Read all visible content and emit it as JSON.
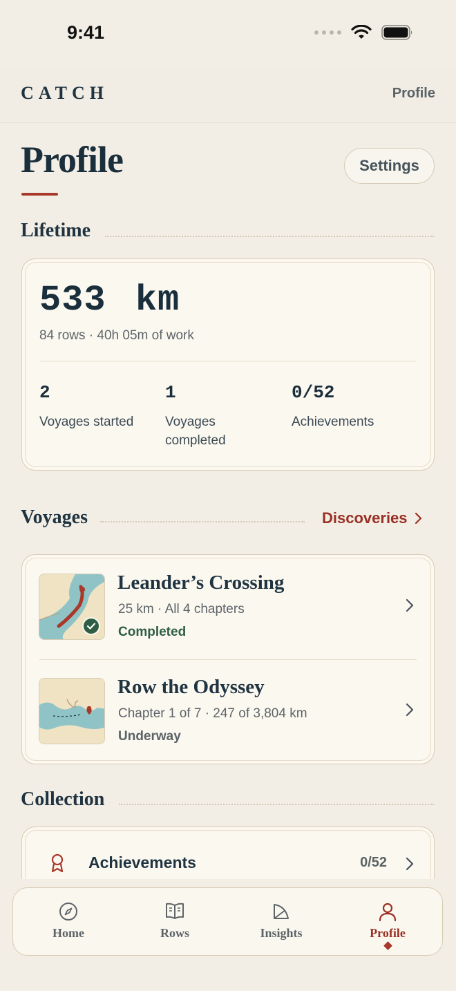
{
  "status_bar": {
    "time": "9:41"
  },
  "header": {
    "brand": "CATCH",
    "page_label": "Profile"
  },
  "page": {
    "title": "Profile",
    "settings_label": "Settings"
  },
  "lifetime": {
    "heading": "Lifetime",
    "distance_value": "533",
    "distance_unit": "km",
    "summary": "84 rows · 40h 05m of work",
    "stats": [
      {
        "value": "2",
        "label": "Voyages started"
      },
      {
        "value": "1",
        "label": "Voyages completed"
      },
      {
        "value": "0/52",
        "label": "Achievements"
      }
    ]
  },
  "voyages": {
    "heading": "Voyages",
    "discoveries_label": "Discoveries",
    "items": [
      {
        "title": "Leander’s Crossing",
        "meta": "25 km · All 4 chapters",
        "status": "Completed",
        "status_color": "#2f5e45",
        "thumb_icon": "strait-map-thumbnail"
      },
      {
        "title": "Row the Odyssey",
        "meta": "Chapter 1 of 7 · 247 of 3,804 km",
        "status": "Underway",
        "status_color": "#5a6266",
        "thumb_icon": "mediterranean-map-thumbnail"
      }
    ]
  },
  "collection": {
    "heading": "Collection",
    "items": [
      {
        "title": "Achievements",
        "count": "0/52",
        "icon": "ribbon-award-icon"
      }
    ]
  },
  "tabs": [
    {
      "label": "Home",
      "icon": "compass-icon",
      "active": false
    },
    {
      "label": "Rows",
      "icon": "book-icon",
      "active": false
    },
    {
      "label": "Insights",
      "icon": "chart-icon",
      "active": false
    },
    {
      "label": "Profile",
      "icon": "person-icon",
      "active": true
    }
  ],
  "colors": {
    "accent": "#9a3124",
    "ink": "#1f3340",
    "background": "#f2eee6",
    "card": "#fbf8f0"
  }
}
